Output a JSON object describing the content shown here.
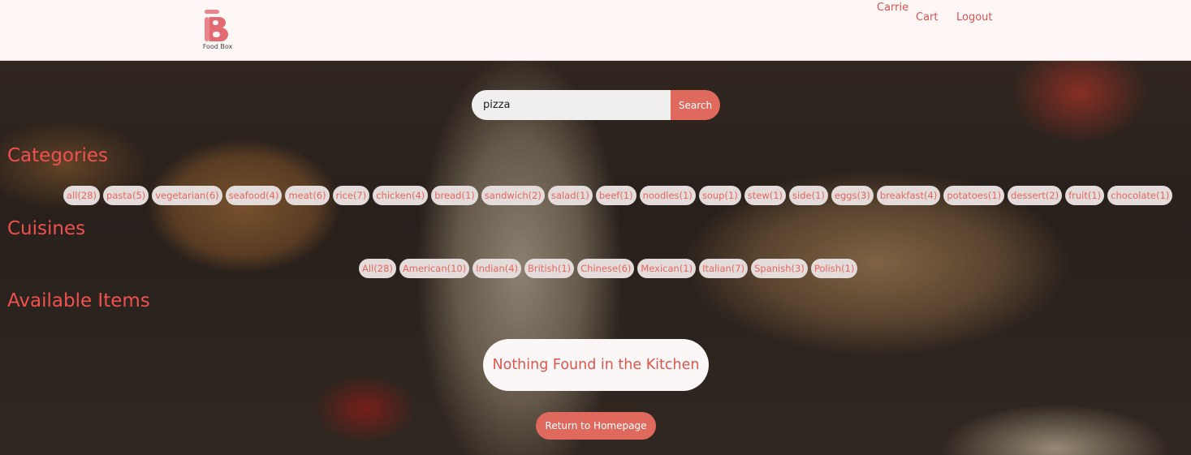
{
  "header": {
    "logo_text": "Food Box",
    "user_name": "Carrie",
    "cart_label": "Cart",
    "logout_label": "Logout"
  },
  "search": {
    "value": "pizza",
    "button_label": "Search"
  },
  "categories": {
    "title": "Categories",
    "items": [
      {
        "label": "all",
        "count": "(28)"
      },
      {
        "label": "pasta",
        "count": "(5)"
      },
      {
        "label": "vegetarian",
        "count": "(6)"
      },
      {
        "label": "seafood",
        "count": "(4)"
      },
      {
        "label": "meat",
        "count": "(6)"
      },
      {
        "label": "rice",
        "count": "(7)"
      },
      {
        "label": "chicken",
        "count": "(4)"
      },
      {
        "label": "bread",
        "count": "(1)"
      },
      {
        "label": "sandwich",
        "count": "(2)"
      },
      {
        "label": "salad",
        "count": "(1)"
      },
      {
        "label": "beef",
        "count": "(1)"
      },
      {
        "label": "noodles",
        "count": "(1)"
      },
      {
        "label": "soup",
        "count": "(1)"
      },
      {
        "label": "stew",
        "count": "(1)"
      },
      {
        "label": "side",
        "count": "(1)"
      },
      {
        "label": "eggs",
        "count": "(3)"
      },
      {
        "label": "breakfast",
        "count": "(4)"
      },
      {
        "label": "potatoes",
        "count": "(1)"
      },
      {
        "label": "dessert",
        "count": "(2)"
      },
      {
        "label": "fruit",
        "count": "(1)"
      },
      {
        "label": "chocolate",
        "count": "(1)"
      }
    ]
  },
  "cuisines": {
    "title": "Cuisines",
    "items": [
      {
        "label": "All",
        "count": "(28)"
      },
      {
        "label": "American",
        "count": "(10)"
      },
      {
        "label": "Indian",
        "count": "(4)"
      },
      {
        "label": "British",
        "count": "(1)"
      },
      {
        "label": "Chinese",
        "count": "(6)"
      },
      {
        "label": "Mexican",
        "count": "(1)"
      },
      {
        "label": "Italian",
        "count": "(7)"
      },
      {
        "label": "Spanish",
        "count": "(3)"
      },
      {
        "label": "Polish",
        "count": "(1)"
      }
    ]
  },
  "items_section": {
    "title": "Available Items",
    "empty_message": "Nothing Found in the Kitchen",
    "home_button_label": "Return to Homepage"
  },
  "colors": {
    "accent": "#e0695e",
    "heading": "#f0504f",
    "header_bg": "#fff7f6",
    "chip_bg": "#e3dcdb"
  }
}
